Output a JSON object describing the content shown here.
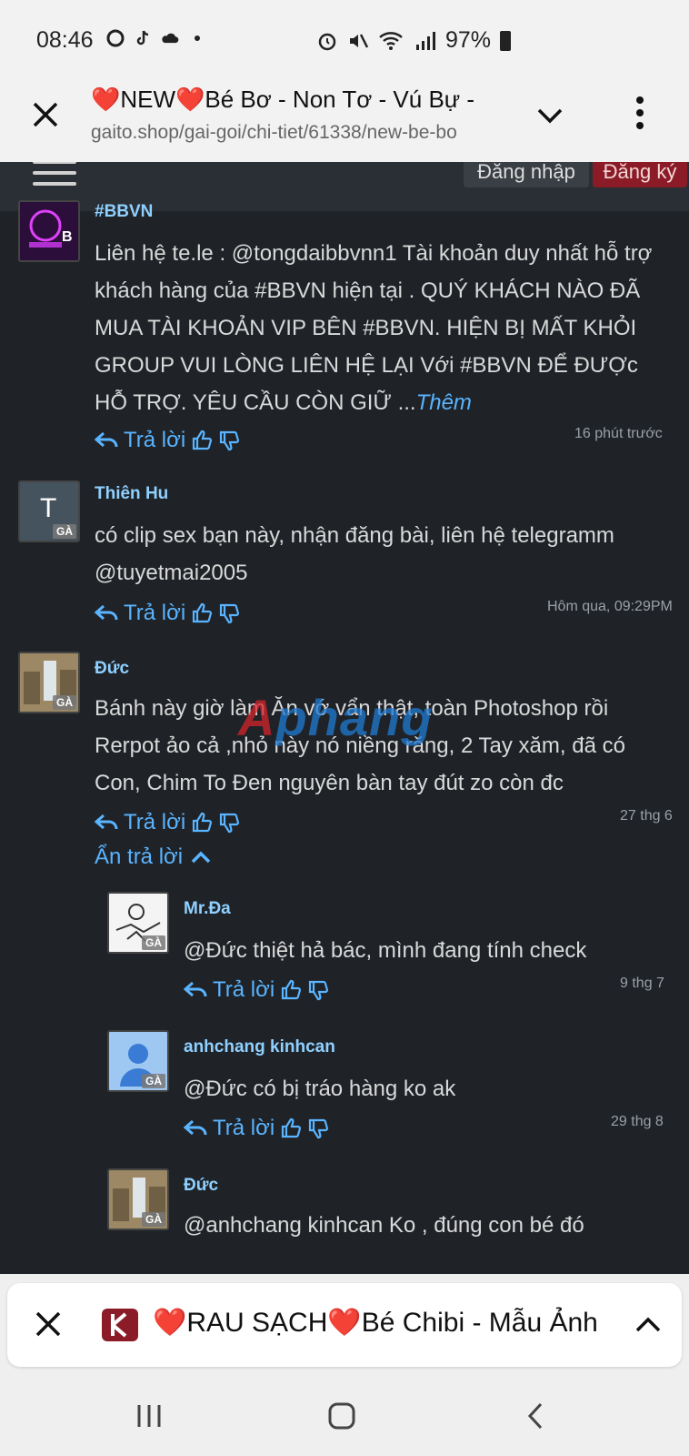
{
  "status_bar": {
    "time": "08:46",
    "battery": "97%"
  },
  "browser": {
    "tab_title": "❤️NEW❤️Bé Bơ - Non Tơ - Vú Bự -",
    "url": "gaito.shop/gai-goi/chi-tiet/61338/new-be-bo"
  },
  "site": {
    "login_label": "Đăng nhập",
    "register_label": "Đăng ký",
    "watermark": "Aphang",
    "colors": {
      "bg": "#1f2328",
      "link": "#5ab4ff",
      "username": "#8fd0ff",
      "register": "#8b1c27"
    }
  },
  "labels": {
    "reply": "Trả lời",
    "more": "Thêm",
    "hide_replies": "Ẩn trả lời",
    "badge": "GÀ"
  },
  "comments": [
    {
      "user": "#BBVN",
      "text": "Liên hệ te.le : @tongdaibbvnn1 Tài khoản duy nhất hỗ trợ khách hàng của #BBVN hiện tại . QUÝ KHÁCH NÀO ĐÃ MUA TÀI KHOẢN VIP BÊN #BBVN. HIỆN BỊ MẤT KHỎI GROUP VUI LÒNG LIÊN HỆ LẠI Với #BBVN ĐỂ ĐƯỢc HỖ TRỢ. YÊU CẦU CÒN GIỮ ...",
      "time": "16 phút trước",
      "avatar_letter": "B"
    },
    {
      "user": "Thiên Hu",
      "text": "có clip sex bạn này, nhận đăng bài, liên hệ telegramm @tuyetmai2005",
      "time": "Hôm qua, 09:29PM",
      "avatar_letter": "T"
    },
    {
      "user": "Đức",
      "text": "Bánh này giờ làm Ăn vớ vẩn thật, toàn Photoshop rồi Rerpot ảo cả ,nhỏ này nó niềng răng, 2 Tay xăm, đã có Con, Chim To Đen nguyên bàn tay đút zo còn đc",
      "time": "27 thg 6"
    }
  ],
  "replies": [
    {
      "user": "Mr.Đa",
      "text": "@Đức thiệt hả bác, mình đang tính check",
      "time": "9 thg 7"
    },
    {
      "user": "anhchang kinhcan",
      "text": "@Đức có bị tráo hàng ko ak",
      "time": "29 thg 8"
    },
    {
      "user": "Đức",
      "text": "@anhchang kinhcan Ko , đúng con bé đó",
      "time": ""
    }
  ],
  "bottom_tab": {
    "title": "❤️RAU SẠCH❤️Bé Chibi - Mẫu Ảnh"
  },
  "icons": [
    "close-icon",
    "chevron-down-icon",
    "kebab-menu-icon",
    "hamburger-icon",
    "reply-icon",
    "thumbs-up-icon",
    "thumbs-down-icon",
    "chevron-up-icon",
    "recent-apps-icon",
    "home-icon",
    "back-icon"
  ]
}
